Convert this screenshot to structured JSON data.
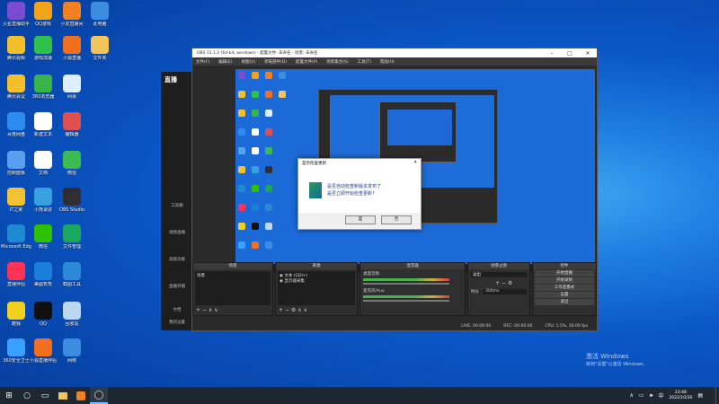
{
  "desktop_icons": [
    {
      "label": "火星直播助手",
      "icon": "anime-icon",
      "color": "#7b4bd1"
    },
    {
      "label": "QQ游戏",
      "icon": "qqgame-icon",
      "color": "#f2a319"
    },
    {
      "label": "小爱直播间",
      "icon": "fox-icon",
      "color": "#f08020"
    },
    {
      "label": "此电脑",
      "icon": "pc-icon",
      "color": "#3b8de0"
    },
    {
      "label": "腾讯视频",
      "icon": "video-icon",
      "color": "#f3c02a"
    },
    {
      "label": "游戏加速",
      "icon": "speed-icon",
      "color": "#2fbf4a"
    },
    {
      "label": "小狐直播",
      "icon": "fox2-icon",
      "color": "#f07020"
    },
    {
      "label": "文件夹",
      "icon": "folder-icon",
      "color": "#f2c45a"
    },
    {
      "label": "腾讯会议",
      "icon": "meeting-icon",
      "color": "#f3c02a"
    },
    {
      "label": "360浏览器",
      "icon": "browser-icon",
      "color": "#38b449"
    },
    {
      "label": "网易",
      "icon": "cursor-icon",
      "color": "#ddeeff"
    },
    {
      "label": "",
      "icon": "blank-icon",
      "color": "transparent"
    },
    {
      "label": "百度网盘",
      "icon": "cloud-icon",
      "color": "#2d8cf0"
    },
    {
      "label": "新建文本",
      "icon": "doc-icon",
      "color": "#ffffff"
    },
    {
      "label": "编辑器",
      "icon": "edit-icon",
      "color": "#e05050"
    },
    {
      "label": "",
      "icon": "blank-icon",
      "color": "transparent"
    },
    {
      "label": "控制面板",
      "icon": "panel-icon",
      "color": "#5aa0f0"
    },
    {
      "label": "文档",
      "icon": "doc2-icon",
      "color": "#ffffff"
    },
    {
      "label": "微信",
      "icon": "chrome-icon",
      "color": "#3cba54"
    },
    {
      "label": "",
      "icon": "blank-icon",
      "color": "transparent"
    },
    {
      "label": "IT之家",
      "icon": "phone-icon",
      "color": "#f2c230"
    },
    {
      "label": "小熊录屏",
      "icon": "rec-icon",
      "color": "#39a0e0"
    },
    {
      "label": "OBS Studio",
      "icon": "obs-icon",
      "color": "#302e31"
    },
    {
      "label": "",
      "icon": "blank-icon",
      "color": "transparent"
    },
    {
      "label": "Microsoft Edge",
      "icon": "edge-icon",
      "color": "#1f8ad2"
    },
    {
      "label": "微信",
      "icon": "wechat-icon",
      "color": "#2dc100"
    },
    {
      "label": "文件管理",
      "icon": "files-icon",
      "color": "#1aa860"
    },
    {
      "label": "",
      "icon": "blank-icon",
      "color": "transparent"
    },
    {
      "label": "直播伴侣",
      "icon": "live-icon",
      "color": "#ff3355"
    },
    {
      "label": "美图秀秀",
      "icon": "pic-icon",
      "color": "#1a7fd8"
    },
    {
      "label": "截图工具",
      "icon": "shot-icon",
      "color": "#2a8ad8"
    },
    {
      "label": "",
      "icon": "blank-icon",
      "color": "transparent"
    },
    {
      "label": "酷我",
      "icon": "music-icon",
      "color": "#f2d020"
    },
    {
      "label": "QQ",
      "icon": "penguin-icon",
      "color": "#111111"
    },
    {
      "label": "回收站",
      "icon": "bin-icon",
      "color": "#bcd7f0"
    },
    {
      "label": "",
      "icon": "blank-icon",
      "color": "transparent"
    },
    {
      "label": "360安全卫士",
      "icon": "shield-icon",
      "color": "#3aa0ff"
    },
    {
      "label": "小狐直播伴侣",
      "icon": "fox3-icon",
      "color": "#f07020"
    },
    {
      "label": "网络",
      "icon": "globe-icon",
      "color": "#3b8de0"
    }
  ],
  "side_panel": {
    "logo": "直播",
    "items": [
      "工具箱",
      "视频直播",
      "高级功能",
      "直播开播",
      "文档",
      "我的设置"
    ]
  },
  "obs": {
    "title": "OBS 31.1.2 (64-bit, windows) - 配置文件: 未命名 - 场景: 未命名",
    "menu": [
      "文件(F)",
      "编辑(E)",
      "视图(V)",
      "停靠部件(D)",
      "配置文件(P)",
      "场景集合(S)",
      "工具(T)",
      "帮助(H)"
    ],
    "docks": {
      "scenes": {
        "title": "场景",
        "items": [
          "场景"
        ]
      },
      "sources": {
        "title": "来源",
        "items": [
          "文本 (GDI+)",
          "显示器采集"
        ]
      },
      "mixer": {
        "title": "混音器",
        "tracks": [
          "桌面音频",
          "麦克风/Aux"
        ]
      },
      "transitions": {
        "title": "场景过渡",
        "type": "淡出",
        "duration_label": "时长",
        "duration": "300ms"
      },
      "controls": {
        "title": "控件",
        "buttons": [
          "开始直播",
          "开始录制",
          "工作室模式",
          "设置",
          "退出"
        ]
      }
    },
    "status": {
      "live": "LIVE: 00:00:00",
      "rec": "REC: 00:00:00",
      "cpu": "CPU: 1.5%, 30.00 fps"
    }
  },
  "dialog": {
    "title": "是否检查更新",
    "message_line1": "是否自动检查新版本发布了",
    "message_line2": "是否立即开始检查更新?",
    "ok": "是",
    "cancel": "否"
  },
  "watermark": {
    "line1": "激活 Windows",
    "line2": "转到\"设置\"以激活 Windows。"
  },
  "taskbar": {
    "time": "23:48",
    "date": "2022/10/30",
    "ime": "中"
  }
}
